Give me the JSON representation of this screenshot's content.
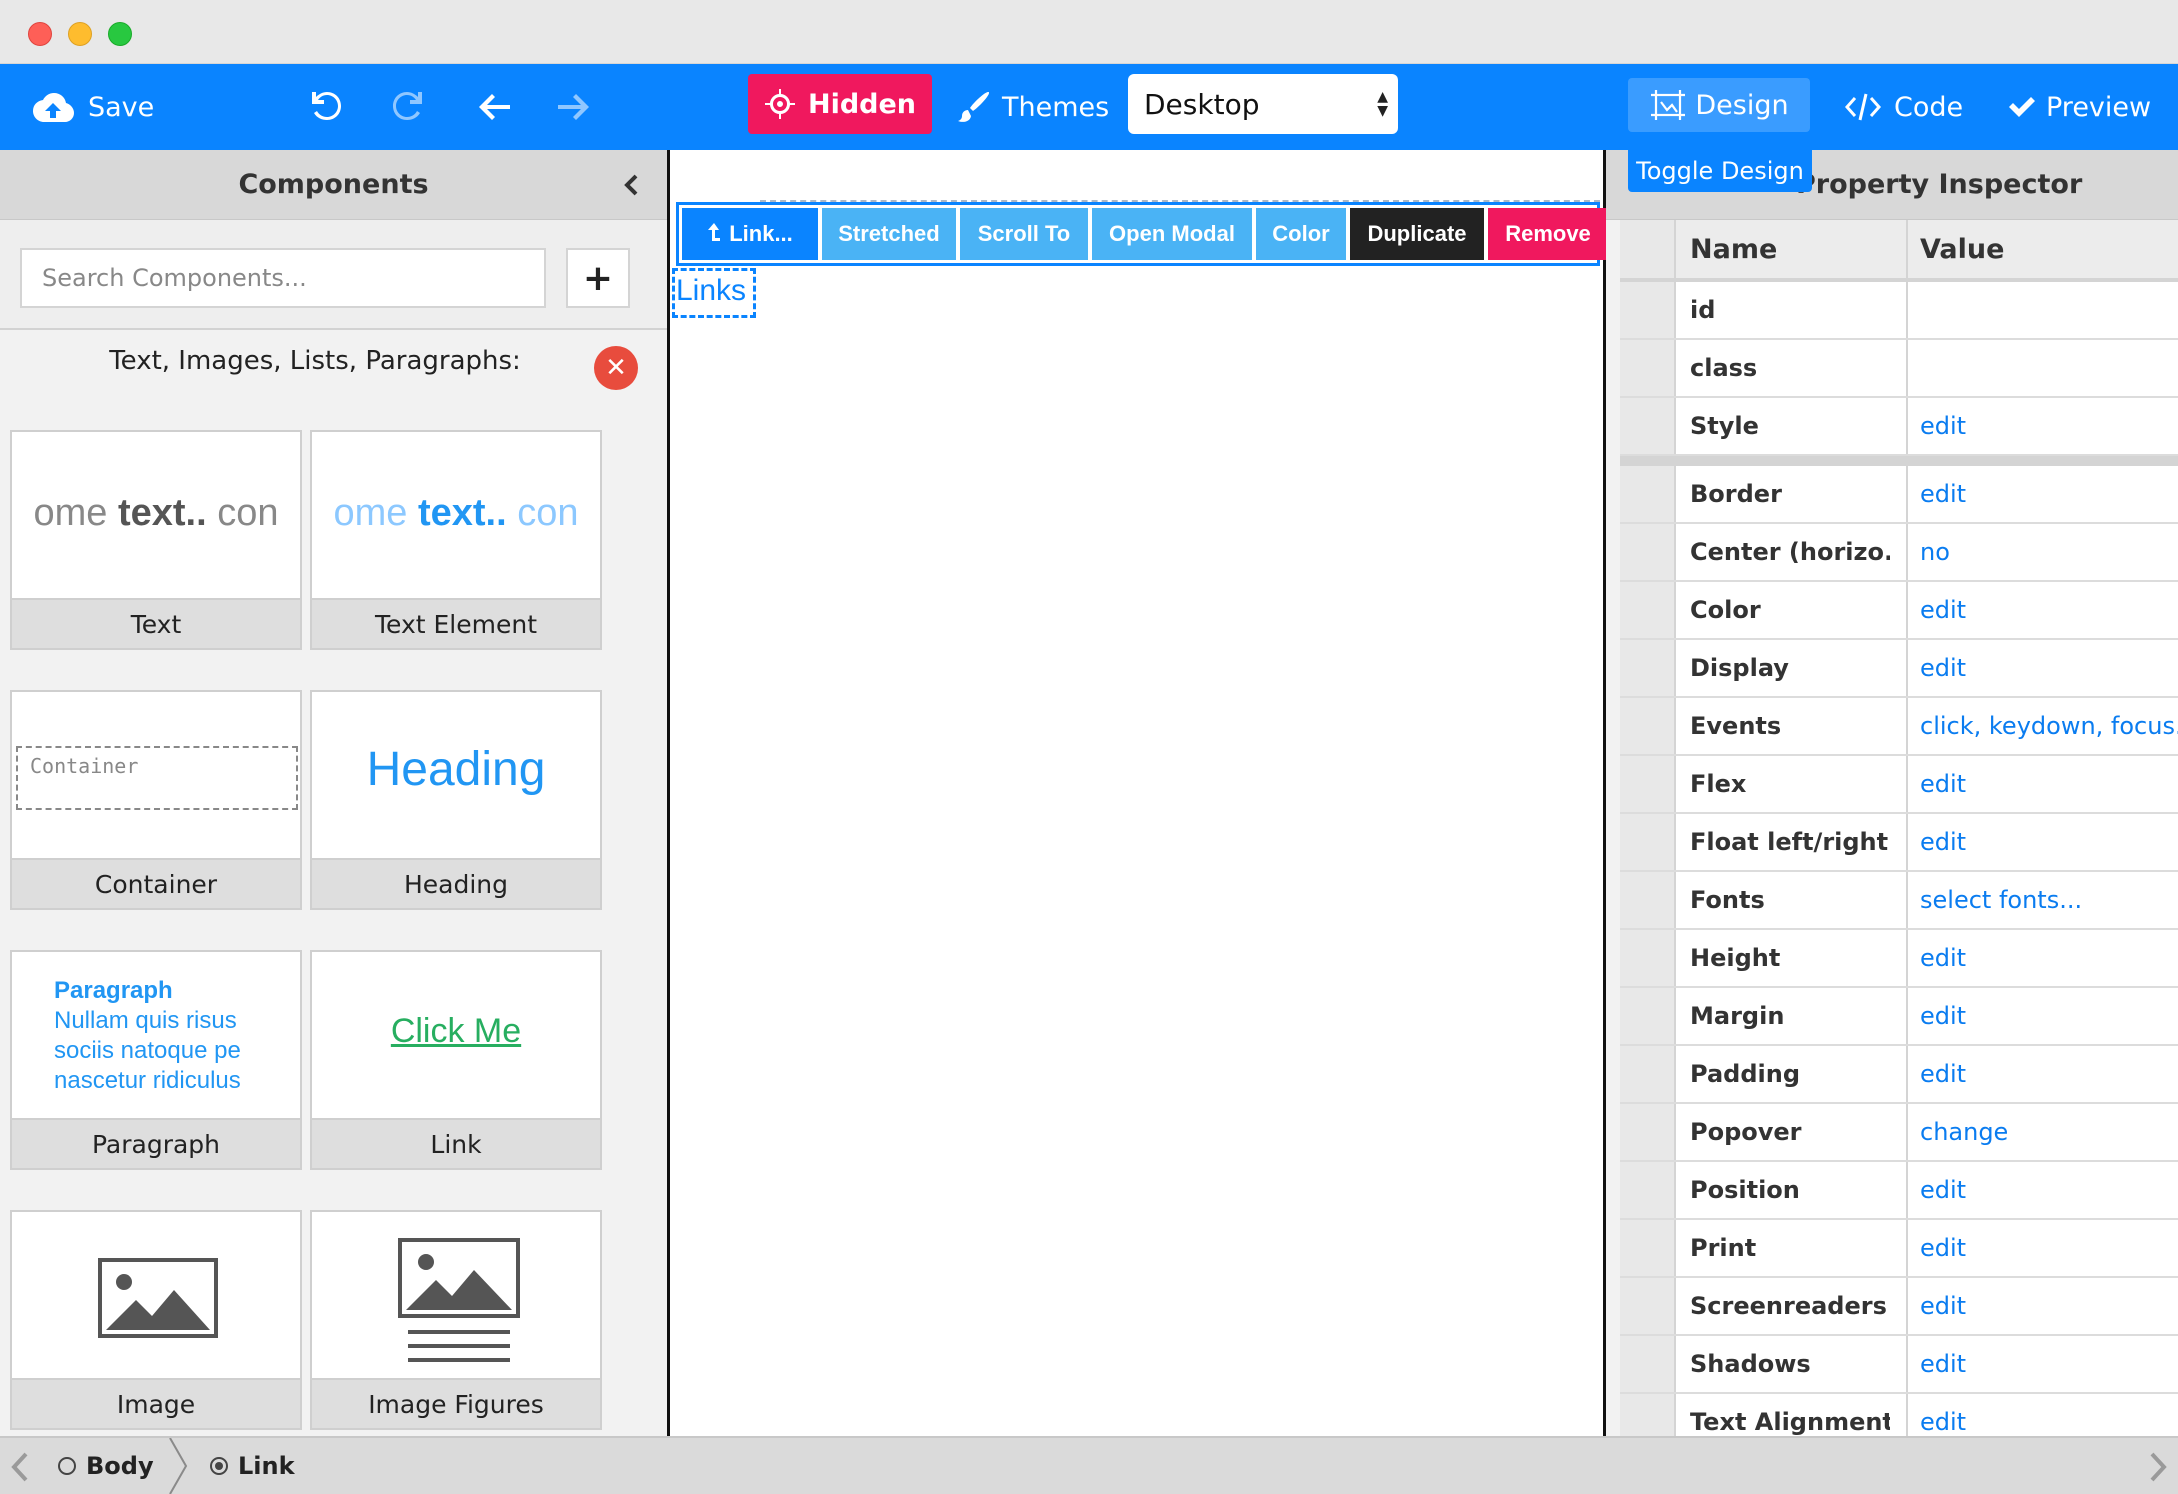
{
  "toolbar": {
    "save_label": "Save",
    "hidden_label": "Hidden",
    "themes_label": "Themes",
    "device_value": "Desktop",
    "design_label": "Design",
    "code_label": "Code",
    "preview_label": "Preview",
    "tooltip": "Toggle Design"
  },
  "left_panel": {
    "title": "Components",
    "search_placeholder": "Search Components...",
    "add_label": "+",
    "category_title": "Text, Images, Lists, Paragraphs:",
    "components": [
      {
        "label": "Text",
        "preview_pre": "ome ",
        "preview_mid": "text..",
        "preview_post": " con"
      },
      {
        "label": "Text Element",
        "preview_pre": "ome ",
        "preview_mid": "text..",
        "preview_post": " con"
      },
      {
        "label": "Container",
        "preview": "Container"
      },
      {
        "label": "Heading",
        "preview": "Heading"
      },
      {
        "label": "Paragraph",
        "preview_title": "Paragraph",
        "preview_body": "Nullam quis risus sociis natoque pe nascetur ridiculus"
      },
      {
        "label": "Link",
        "preview": "Click Me"
      },
      {
        "label": "Image"
      },
      {
        "label": "Image Figures"
      }
    ]
  },
  "canvas": {
    "selection_toolbar": {
      "link": "Link...",
      "stretched": "Stretched",
      "scroll_to": "Scroll To",
      "open_modal": "Open Modal",
      "color": "Color",
      "duplicate": "Duplicate",
      "remove": "Remove"
    },
    "link_text": "Links"
  },
  "right_panel": {
    "title": "Property Inspector",
    "header": {
      "name": "Name",
      "value": "Value"
    },
    "properties_top": [
      {
        "name": "id",
        "value": ""
      },
      {
        "name": "class",
        "value": ""
      },
      {
        "name": "Style",
        "value": "edit"
      }
    ],
    "properties": [
      {
        "name": "Border",
        "value": "edit"
      },
      {
        "name": "Center (horizo...",
        "value": "no"
      },
      {
        "name": "Color",
        "value": "edit"
      },
      {
        "name": "Display",
        "value": "edit"
      },
      {
        "name": "Events",
        "value": "click, keydown, focus..."
      },
      {
        "name": "Flex",
        "value": "edit"
      },
      {
        "name": "Float left/right",
        "value": "edit"
      },
      {
        "name": "Fonts",
        "value": "select fonts..."
      },
      {
        "name": "Height",
        "value": "edit"
      },
      {
        "name": "Margin",
        "value": "edit"
      },
      {
        "name": "Padding",
        "value": "edit"
      },
      {
        "name": "Popover",
        "value": "change"
      },
      {
        "name": "Position",
        "value": "edit"
      },
      {
        "name": "Print",
        "value": "edit"
      },
      {
        "name": "Screenreaders",
        "value": "edit"
      },
      {
        "name": "Shadows",
        "value": "edit"
      },
      {
        "name": "Text Alignment",
        "value": "edit"
      }
    ]
  },
  "breadcrumb": {
    "items": [
      "Body",
      "Link"
    ]
  },
  "colors": {
    "toolbar_blue": "#0a84ff",
    "hidden_pink": "#f0185e",
    "link_blue": "#0a7cf0",
    "remove_pink": "#f0185e"
  }
}
